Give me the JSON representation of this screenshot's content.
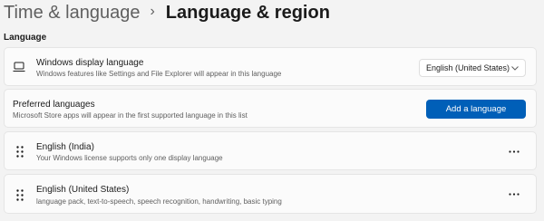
{
  "breadcrumb": {
    "parent": "Time & language",
    "separator": "›",
    "current": "Language & region"
  },
  "section": {
    "label": "Language"
  },
  "display_language": {
    "icon": "laptop-icon",
    "title": "Windows display language",
    "description": "Windows features like Settings and File Explorer will appear in this language",
    "dropdown_value": "English (United States)"
  },
  "preferred_languages": {
    "title": "Preferred languages",
    "description": "Microsoft Store apps will appear in the first supported language in this list",
    "button_label": "Add a language"
  },
  "languages": [
    {
      "name": "English (India)",
      "detail": "Your Windows license supports only one display language"
    },
    {
      "name": "English (United States)",
      "detail": "language pack, text-to-speech, speech recognition, handwriting, basic typing"
    }
  ],
  "colors": {
    "accent": "#005fb8",
    "background": "#f3f3f3",
    "card": "#fbfbfb"
  }
}
